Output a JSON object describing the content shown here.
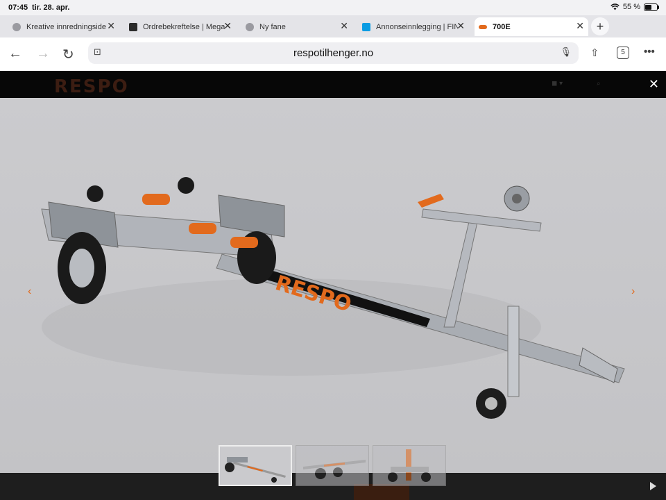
{
  "status": {
    "time": "07:45",
    "date": "tir. 28. apr.",
    "battery": "55 %",
    "battery_level": 0.55
  },
  "tabs": [
    {
      "title": "Kreative innredningside",
      "icon": "globe-icon",
      "active": false
    },
    {
      "title": "Ordrebekreftelse | Mega",
      "icon": "site-icon",
      "active": false
    },
    {
      "title": "Ny fane",
      "icon": "globe-icon",
      "active": false
    },
    {
      "title": "Annonseinnlegging | FIN",
      "icon": "finn-icon",
      "active": false
    },
    {
      "title": "700E",
      "icon": "respo-icon",
      "active": true
    }
  ],
  "toolbar": {
    "url": "respotilhenger.no",
    "tab_count": "5"
  },
  "site": {
    "logo": "RESPO"
  },
  "gallery": {
    "images": [
      "image-1",
      "image-2",
      "image-3"
    ],
    "selected": 0
  },
  "colors": {
    "accent": "#e26a1d",
    "header": "#070707",
    "stage": "#c9c9cc"
  }
}
